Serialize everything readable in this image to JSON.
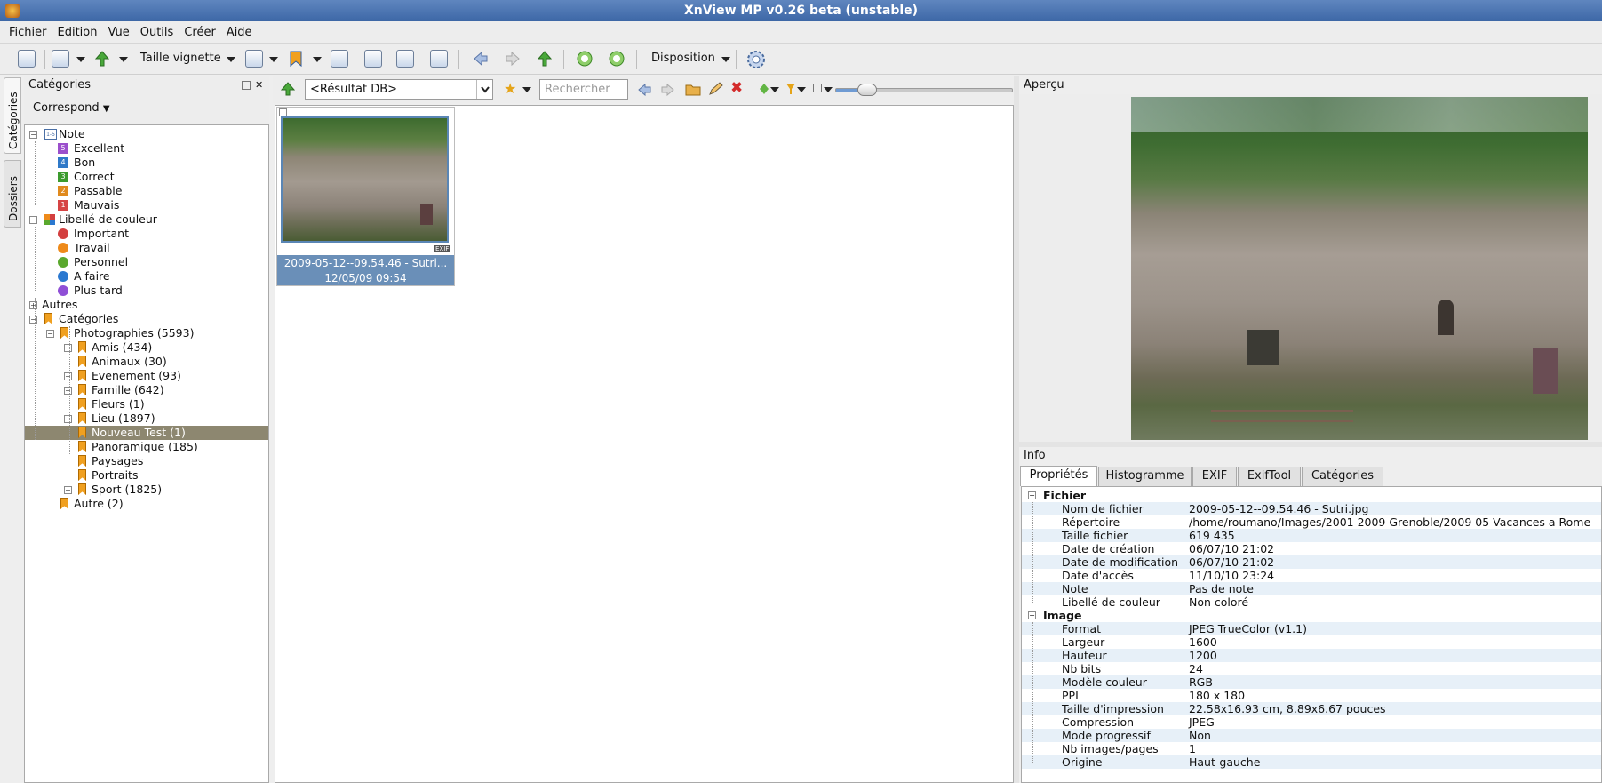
{
  "window": {
    "title": "XnView MP v0.26 beta (unstable)"
  },
  "menu": [
    "Fichier",
    "Edition",
    "Vue",
    "Outils",
    "Créer",
    "Aide"
  ],
  "toolbar": {
    "thumb_size_label": "Taille vignette",
    "layout_label": "Disposition"
  },
  "left_tabs": [
    "Catégories",
    "Dossiers"
  ],
  "categories_panel": {
    "title": "Catégories",
    "match_label": "Correspond",
    "tree": [
      {
        "label": "Note",
        "kind": "rating-root",
        "expand": "-"
      },
      {
        "label": "Excellent",
        "kind": "rating",
        "rating": "5",
        "color": "#9b4fcc"
      },
      {
        "label": "Bon",
        "kind": "rating",
        "rating": "4",
        "color": "#2f79c8"
      },
      {
        "label": "Correct",
        "kind": "rating",
        "rating": "3",
        "color": "#3c9b2e"
      },
      {
        "label": "Passable",
        "kind": "rating",
        "rating": "2",
        "color": "#e08a1e"
      },
      {
        "label": "Mauvais",
        "kind": "rating",
        "rating": "1",
        "color": "#d64444"
      },
      {
        "label": "Libellé de couleur",
        "kind": "color-root",
        "expand": "-"
      },
      {
        "label": "Important",
        "kind": "color",
        "color": "#d33f3f"
      },
      {
        "label": "Travail",
        "kind": "color",
        "color": "#ee8a1a"
      },
      {
        "label": "Personnel",
        "kind": "color",
        "color": "#5aa82d"
      },
      {
        "label": "A faire",
        "kind": "color",
        "color": "#2a78d0"
      },
      {
        "label": "Plus tard",
        "kind": "color",
        "color": "#8f4fd6"
      },
      {
        "label": "Autres",
        "kind": "plain",
        "expand": "+"
      },
      {
        "label": "Catégories",
        "kind": "cat-root",
        "expand": "-"
      },
      {
        "label": "Photographies (5593)",
        "kind": "cat",
        "expand": "-"
      },
      {
        "label": "Amis (434)",
        "kind": "cat2",
        "expand": "+"
      },
      {
        "label": "Animaux (30)",
        "kind": "cat2"
      },
      {
        "label": "Evenement (93)",
        "kind": "cat2",
        "expand": "+"
      },
      {
        "label": "Famille (642)",
        "kind": "cat2",
        "expand": "+"
      },
      {
        "label": "Fleurs (1)",
        "kind": "cat2"
      },
      {
        "label": "Lieu (1897)",
        "kind": "cat2",
        "expand": "+"
      },
      {
        "label": "Nouveau Test (1)",
        "kind": "cat2",
        "selected": true
      },
      {
        "label": "Panoramique (185)",
        "kind": "cat2"
      },
      {
        "label": "Paysages",
        "kind": "cat2"
      },
      {
        "label": "Portraits",
        "kind": "cat2"
      },
      {
        "label": "Sport (1825)",
        "kind": "cat2",
        "expand": "+"
      },
      {
        "label": "Autre (2)",
        "kind": "cat"
      }
    ]
  },
  "browser": {
    "path": "<Résultat DB>",
    "search_placeholder": "Rechercher",
    "thumb_name": "2009-05-12--09.54.46 - Sutri...",
    "thumb_date": "12/05/09 09:54",
    "exif_badge": "EXIF"
  },
  "preview": {
    "title": "Aperçu"
  },
  "info": {
    "title": "Info",
    "tabs": [
      "Propriétés",
      "Histogramme",
      "EXIF",
      "ExifTool",
      "Catégories"
    ],
    "groups": [
      {
        "name": "Fichier",
        "rows": [
          {
            "k": "Nom de fichier",
            "v": "2009-05-12--09.54.46 - Sutri.jpg"
          },
          {
            "k": "Répertoire",
            "v": "/home/roumano/Images/2001 2009 Grenoble/2009 05 Vacances a Rome"
          },
          {
            "k": "Taille fichier",
            "v": "619 435"
          },
          {
            "k": "Date de création",
            "v": "06/07/10 21:02"
          },
          {
            "k": "Date de modification",
            "v": "06/07/10 21:02"
          },
          {
            "k": "Date d'accès",
            "v": "11/10/10 23:24"
          },
          {
            "k": "Note",
            "v": "Pas de note"
          },
          {
            "k": "Libellé de couleur",
            "v": "Non coloré"
          }
        ]
      },
      {
        "name": "Image",
        "rows": [
          {
            "k": "Format",
            "v": "JPEG TrueColor (v1.1)"
          },
          {
            "k": "Largeur",
            "v": "1600"
          },
          {
            "k": "Hauteur",
            "v": "1200"
          },
          {
            "k": "Nb bits",
            "v": "24"
          },
          {
            "k": "Modèle couleur",
            "v": "RGB"
          },
          {
            "k": "PPI",
            "v": "180 x 180"
          },
          {
            "k": "Taille d'impression",
            "v": "22.58x16.93 cm, 8.89x6.67 pouces"
          },
          {
            "k": "Compression",
            "v": "JPEG"
          },
          {
            "k": "Mode progressif",
            "v": "Non"
          },
          {
            "k": "Nb images/pages",
            "v": "1"
          },
          {
            "k": "Origine",
            "v": "Haut-gauche"
          }
        ]
      }
    ]
  }
}
